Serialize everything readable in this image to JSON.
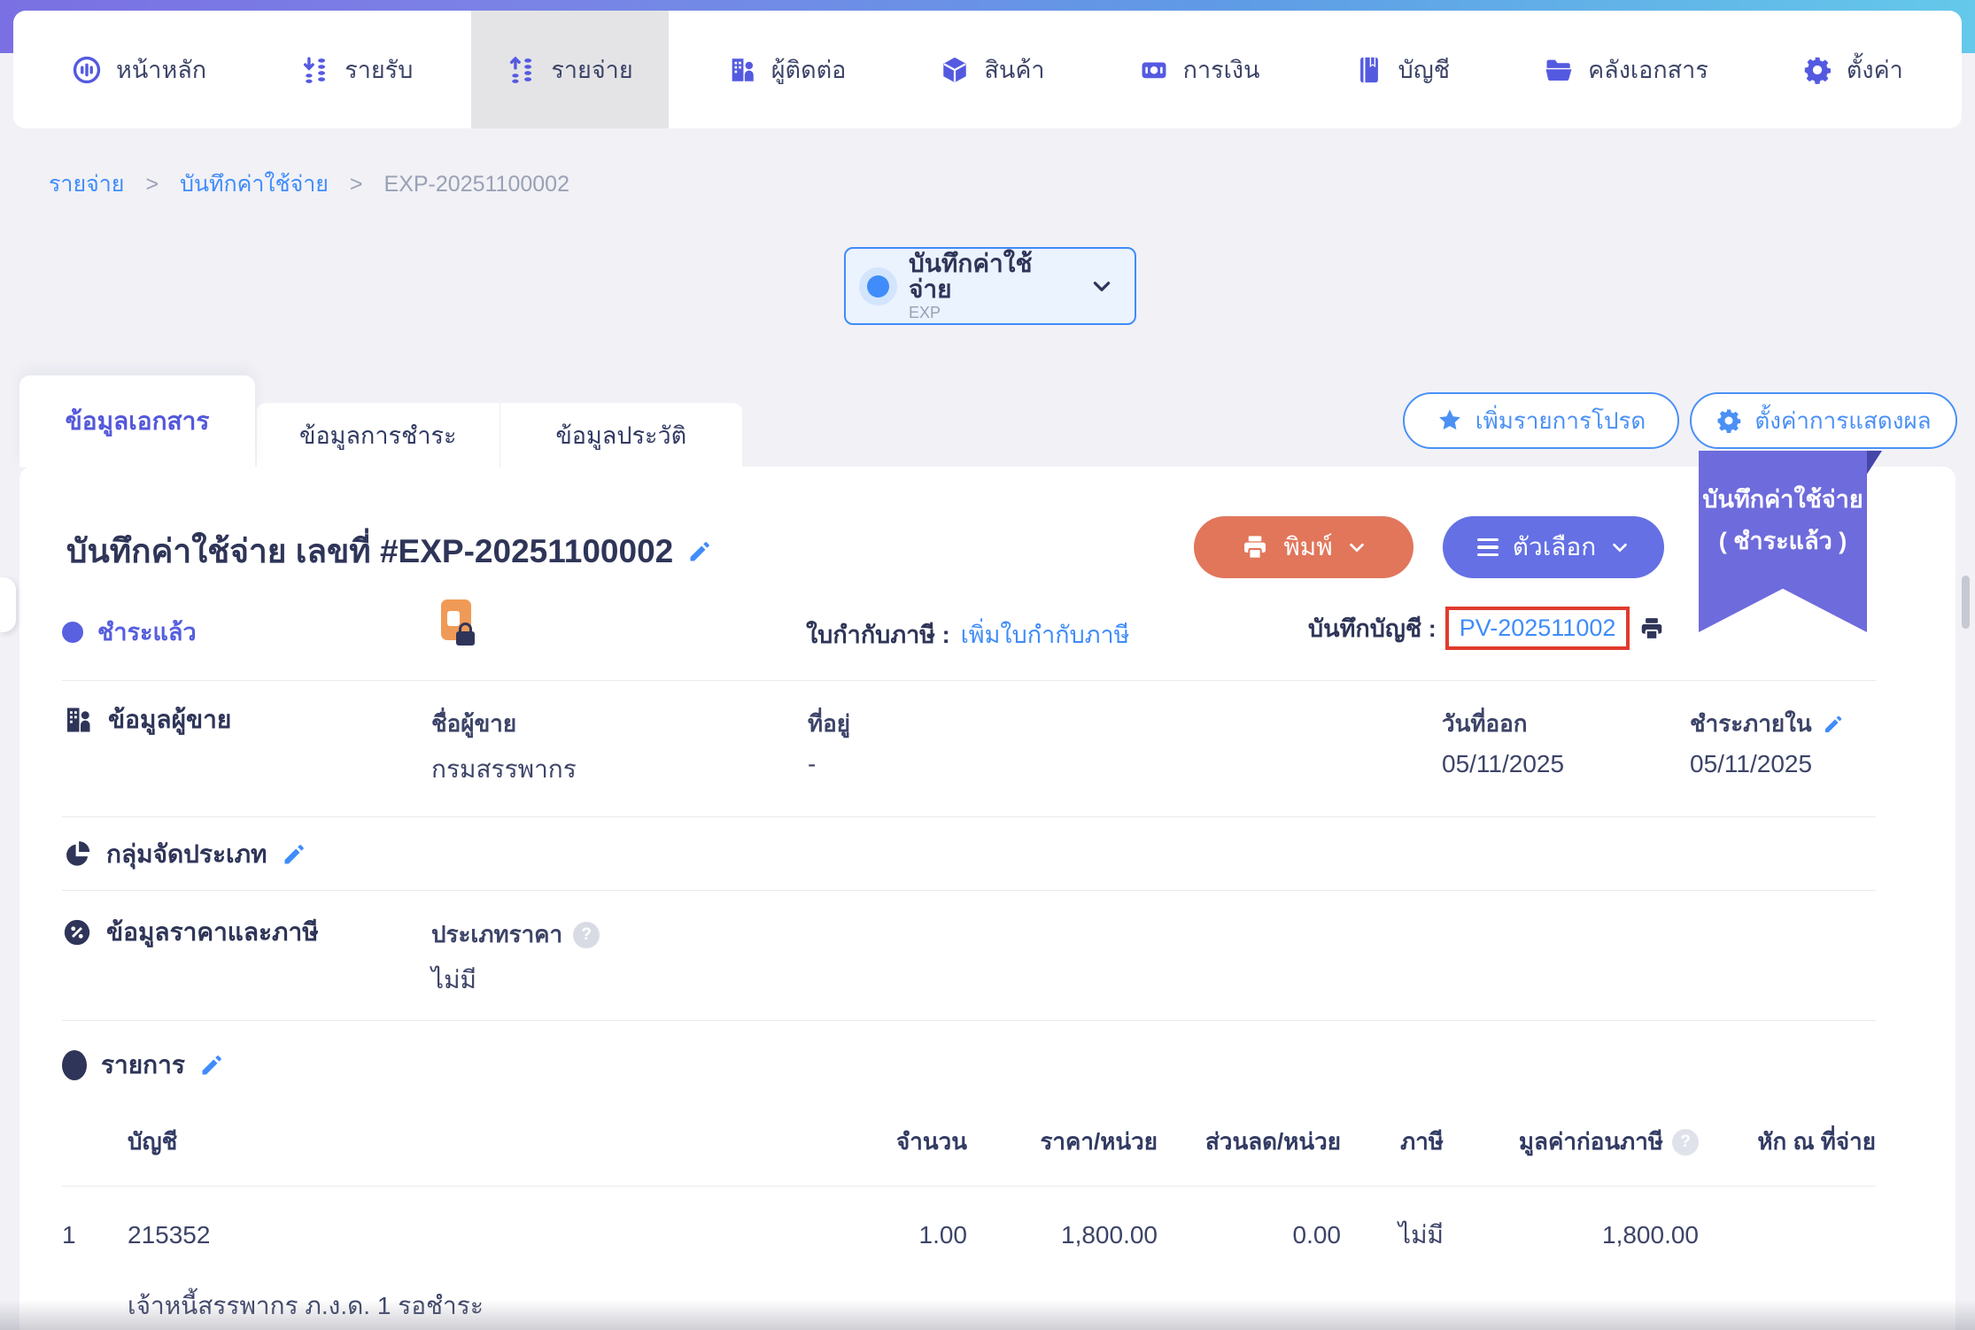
{
  "nav": {
    "items": [
      {
        "label": "หน้าหลัก",
        "icon": "dashboard-icon",
        "active": false
      },
      {
        "label": "รายรับ",
        "icon": "income-icon",
        "active": false
      },
      {
        "label": "รายจ่าย",
        "icon": "expense-icon",
        "active": true
      },
      {
        "label": "ผู้ติดต่อ",
        "icon": "contacts-icon",
        "active": false
      },
      {
        "label": "สินค้า",
        "icon": "products-icon",
        "active": false
      },
      {
        "label": "การเงิน",
        "icon": "finance-icon",
        "active": false
      },
      {
        "label": "บัญชี",
        "icon": "accounting-icon",
        "active": false
      },
      {
        "label": "คลังเอกสาร",
        "icon": "documents-icon",
        "active": false
      },
      {
        "label": "ตั้งค่า",
        "icon": "settings-icon",
        "active": false
      }
    ]
  },
  "breadcrumb": {
    "separator": ">",
    "items": [
      "รายจ่าย",
      "บันทึกค่าใช้จ่าย",
      "EXP-20251100002"
    ]
  },
  "doc_type_selector": {
    "label": "บันทึกค่าใช้จ่าย",
    "code": "EXP",
    "icon": "chevron-down-icon"
  },
  "tabs": [
    {
      "label": "ข้อมูลเอกสาร",
      "active": true
    },
    {
      "label": "ข้อมูลการชำระ",
      "active": false
    },
    {
      "label": "ข้อมูลประวัติ",
      "active": false
    }
  ],
  "actions": {
    "favorite": "เพิ่มรายการโปรด",
    "display_settings": "ตั้งค่าการแสดงผล",
    "print": "พิมพ์",
    "options": "ตัวเลือก"
  },
  "ribbon": {
    "line1": "บันทึกค่าใช้จ่าย",
    "line2": "( ชำระแล้ว )"
  },
  "document": {
    "title": "บันทึกค่าใช้จ่าย เลขที่ #EXP-20251100002",
    "status": "ชำระแล้ว",
    "tax_invoice_label": "ใบกำกับภาษี :",
    "tax_invoice_link": "เพิ่มใบกำกับภาษี",
    "journal_label": "บันทึกบัญชี :",
    "journal_link": "PV-202511002"
  },
  "seller": {
    "section_title": "ข้อมูลผู้ขาย",
    "name_label": "ชื่อผู้ขาย",
    "name_value": "กรมสรรพากร",
    "address_label": "ที่อยู่",
    "address_value": "-",
    "issue_date_label": "วันที่ออก",
    "issue_date_value": "05/11/2025",
    "due_label": "ชำระภายใน",
    "due_value": "05/11/2025"
  },
  "classification": {
    "section_title": "กลุ่มจัดประเภท"
  },
  "pricing": {
    "section_title": "ข้อมูลราคาและภาษี",
    "price_type_label": "ประเภทราคา",
    "price_type_value": "ไม่มี"
  },
  "items": {
    "section_title": "รายการ",
    "columns": [
      "บัญชี",
      "จำนวน",
      "ราคา/หน่วย",
      "ส่วนลด/หน่วย",
      "ภาษี",
      "มูลค่าก่อนภาษี",
      "หัก ณ ที่จ่าย"
    ],
    "rows": [
      {
        "no": "1",
        "account": "215352",
        "qty": "1.00",
        "price": "1,800.00",
        "discount": "0.00",
        "tax": "ไม่มี",
        "pretax": "1,800.00",
        "wht": "",
        "description": "เจ้าหนี้สรรพากร ภ.ง.ด. 1 รอชำระ"
      }
    ]
  },
  "misc": {
    "question_mark": "?"
  },
  "colors": {
    "link_blue": "#3f8cfa",
    "indigo_accent": "#5a61e0",
    "print_button_orange": "#e1765b",
    "options_button_indigo": "#6470e4",
    "ribbon_purple": "#6e6bdc",
    "highlight_red": "#e03b2d",
    "text_dark_navy": "#2f3558",
    "active_nav_gray": "#e4e4e6"
  }
}
